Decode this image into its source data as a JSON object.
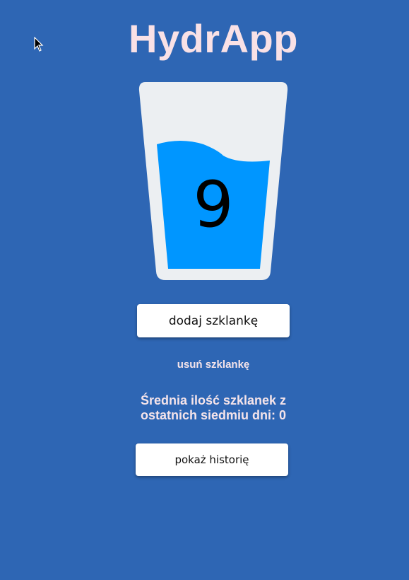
{
  "app": {
    "title": "HydrApp"
  },
  "glass": {
    "count": "9",
    "water_level": 0.78
  },
  "actions": {
    "add_label": "dodaj szklankę",
    "remove_label": "usuń szklankę",
    "history_label": "pokaż historię"
  },
  "stats": {
    "average_text": "Średnia ilość szklanek z ostatnich siedmiu dni: 0"
  },
  "colors": {
    "background": "#2e66b4",
    "title": "#f9e1e6",
    "glass": "#eceff2",
    "water": "#0096ff"
  },
  "icons": {
    "cursor": "mouse-pointer-icon"
  }
}
